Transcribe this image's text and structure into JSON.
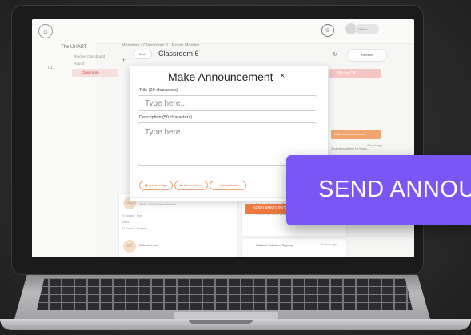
{
  "app": {
    "side_title": "The UHART",
    "side_items": [
      "Teacher Dashboard",
      "Report"
    ],
    "side_active": "Classroom",
    "side_pill": "CL",
    "breadcrumb": "Monsters / Classroom 6 / Room Monitor",
    "back": "Back",
    "class_title": "Classroom 6",
    "refresh": "Refresh",
    "toggle_label": "Offline",
    "phone_off": "Phone Off",
    "announce_tag": "Make Announcement",
    "right_card_time": "6 hours ago",
    "right_card_text": "Student volunteers for library..."
  },
  "modal": {
    "title": "Make Announcement",
    "close": "×",
    "title_label": "Title (20 characters)",
    "title_placeholder": "Type here...",
    "desc_label": "Description (50 characters)",
    "desc_placeholder": "Type here...",
    "upload_image": "Upload Image",
    "upload_video": "Upload Video",
    "upload_audio": "Upload Audio",
    "send_small": "SEND ANNOUNCEMENT"
  },
  "list": {
    "gc": "GC",
    "card_title": "Science 6B",
    "card_sub": "Tenth · Sixth Science Studies",
    "row1": "21 Joined · Now",
    "row2": "Notes",
    "row3": "32 Joined · Science",
    "card2_title": "Science here",
    "ann1_title": "Student Volunteer Sign-up",
    "ann1_time": "6 hours ago",
    "ann1_text": "Student volunteers for the library program needed this week, please see the teacher.",
    "flag": "Flag Video",
    "ann2_title": "Student Volunteer Sign-up",
    "ann2_time": "6 hours ago"
  },
  "overlay": {
    "send_label": "SEND ANNOUNCEMENT"
  },
  "colors": {
    "purple": "#7a57f5",
    "orange": "#f07a3e"
  }
}
